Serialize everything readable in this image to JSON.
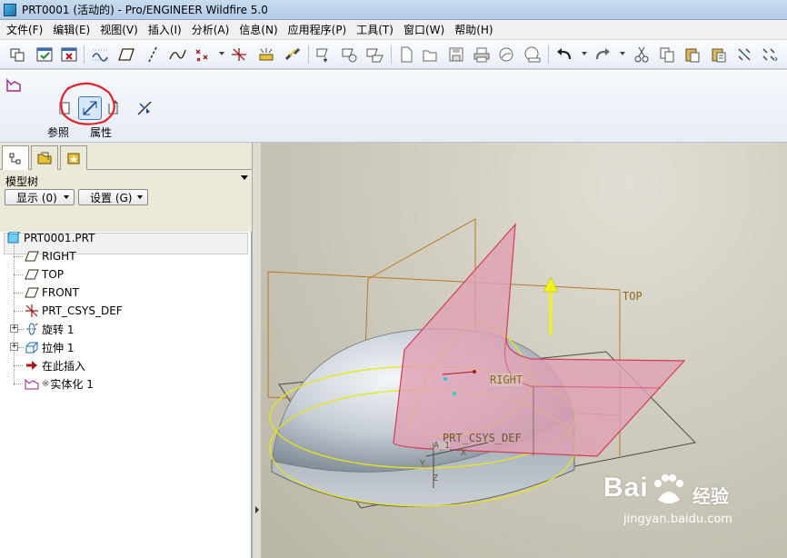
{
  "window": {
    "title": "PRT0001 (活动的) - Pro/ENGINEER Wildfire 5.0"
  },
  "menu": [
    "文件(F)",
    "编辑(E)",
    "视图(V)",
    "插入(I)",
    "分析(A)",
    "信息(N)",
    "应用程序(P)",
    "工具(T)",
    "窗口(W)",
    "帮助(H)"
  ],
  "dashboard": {
    "references_label": "参照",
    "properties_label": "属性",
    "annotation_color": "#e0222a"
  },
  "panel": {
    "header_label": "模型树",
    "show_button": "显示 (0)",
    "settings_button": "设置 (G)"
  },
  "tree": {
    "root": "PRT0001.PRT",
    "items": [
      "RIGHT",
      "TOP",
      "FRONT",
      "PRT_CSYS_DEF",
      "旋转 1",
      "拉伸 1",
      "在此插入",
      "实体化 1"
    ],
    "marker_symbol": "※"
  },
  "viewport": {
    "labels": {
      "top": "TOP",
      "right": "RIGHT",
      "csys": "PRT_CSYS_DEF",
      "axis_a": "A_1",
      "axis_x": "X",
      "axis_y": "Y",
      "axis_z": "Z"
    },
    "colors": {
      "plane_edge": "#b37a2a",
      "selection": "#e6e61a",
      "preview": "#e0a0b4"
    }
  },
  "watermark": {
    "brand": "Bai",
    "sub": "经验",
    "url": "jingyan.baidu.com"
  }
}
